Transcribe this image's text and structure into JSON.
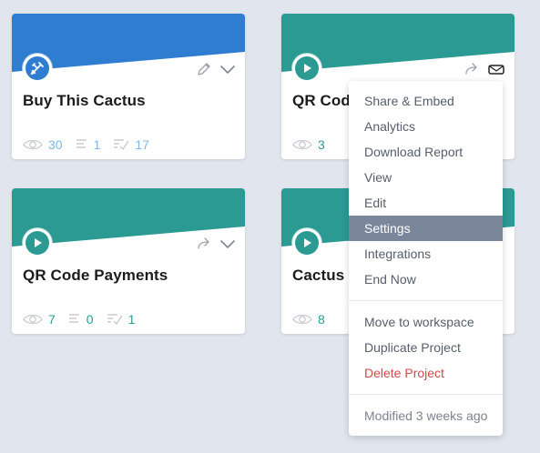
{
  "cards": [
    {
      "title": "Buy This Cactus",
      "banner_color": "#2f7dd1",
      "badge_icon": "pencil-ruler-icon",
      "stats": {
        "views": "30",
        "responses": "1",
        "completions": "17"
      },
      "stat_color": "#7fb6e6"
    },
    {
      "title": "QR Code",
      "banner_color": "#2b9a93",
      "badge_icon": "play-icon",
      "stats": {
        "views": "3"
      },
      "stat_color": "#2b9a93"
    },
    {
      "title": "QR Code Payments",
      "banner_color": "#2b9a93",
      "badge_icon": "play-icon",
      "stats": {
        "views": "7",
        "responses": "0",
        "completions": "1"
      },
      "stat_color": "#2b9a93"
    },
    {
      "title": "Cactus",
      "banner_color": "#2b9a93",
      "badge_icon": "play-icon",
      "stats": {
        "views": "8"
      },
      "stat_color": "#2b9a93"
    }
  ],
  "menu": {
    "items_primary": [
      "Share & Embed",
      "Analytics",
      "Download Report",
      "View",
      "Edit",
      "Settings",
      "Integrations",
      "End Now"
    ],
    "active_item": "Settings",
    "items_secondary": [
      "Move to workspace",
      "Duplicate Project",
      "Delete Project"
    ],
    "footer": "Modified 3 weeks ago"
  }
}
